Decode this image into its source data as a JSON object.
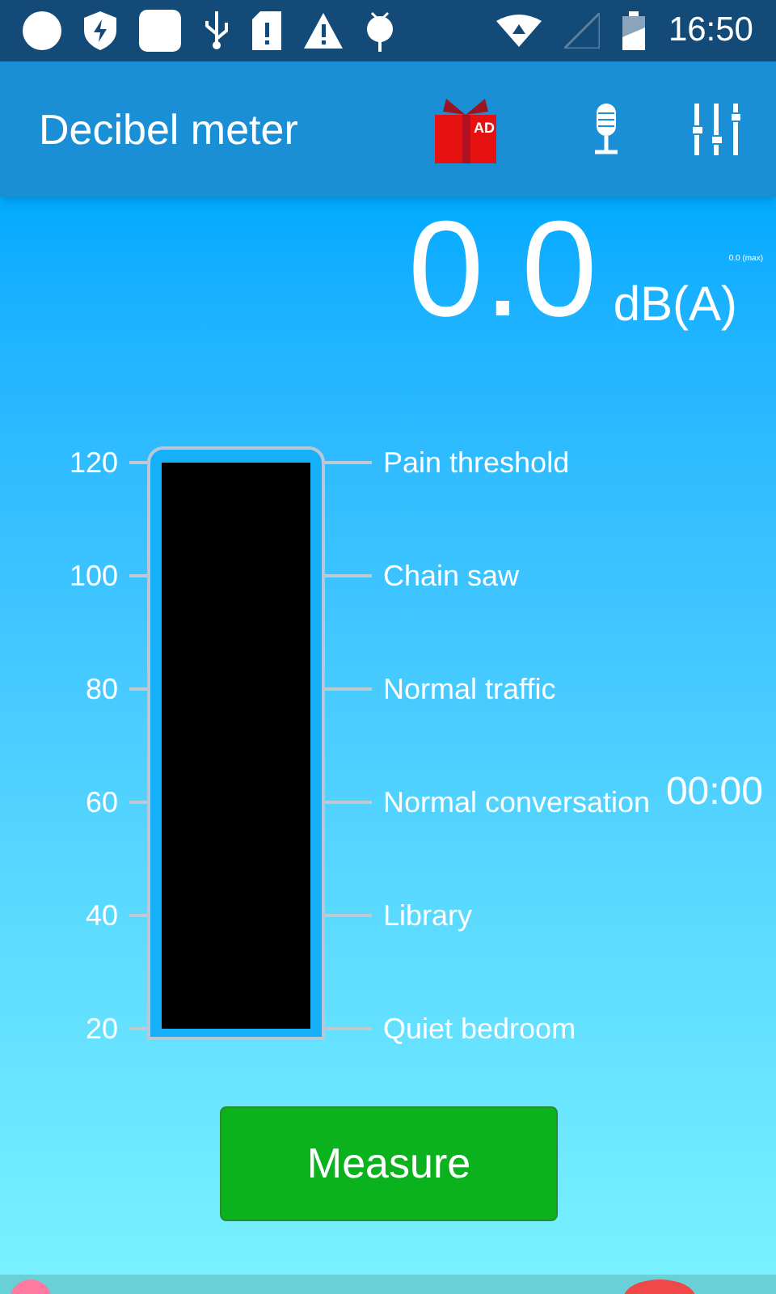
{
  "status_bar": {
    "time": "16:50"
  },
  "app_bar": {
    "title": "Decibel meter",
    "ad_badge": "AD"
  },
  "reading": {
    "value": "0.0",
    "unit": "dB(A)",
    "max": "0.0 (max)"
  },
  "scale": [
    {
      "value": "120",
      "label": "Pain threshold"
    },
    {
      "value": "100",
      "label": "Chain saw"
    },
    {
      "value": "80",
      "label": "Normal traffic"
    },
    {
      "value": "60",
      "label": "Normal conversation"
    },
    {
      "value": "40",
      "label": "Library"
    },
    {
      "value": "20",
      "label": "Quiet bedroom"
    }
  ],
  "timer": "00:00",
  "measure_button": "Measure"
}
